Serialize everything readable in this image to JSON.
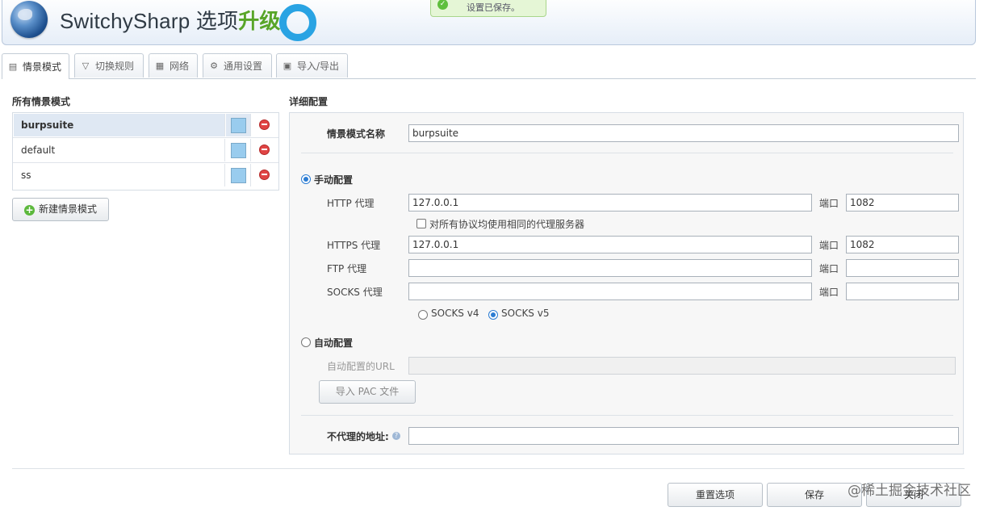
{
  "header": {
    "title": "SwitchySharp 选项",
    "upgrade": "升级"
  },
  "toast": {
    "message": "设置已保存。"
  },
  "tabs": [
    {
      "label": "情景模式",
      "icon": "profile-icon"
    },
    {
      "label": "切换规则",
      "icon": "filter-icon"
    },
    {
      "label": "网络",
      "icon": "network-icon"
    },
    {
      "label": "通用设置",
      "icon": "gear-icon"
    },
    {
      "label": "导入/导出",
      "icon": "save-icon"
    }
  ],
  "left": {
    "title": "所有情景模式",
    "profiles": [
      {
        "name": "burpsuite",
        "color": "#99ccee",
        "selected": true
      },
      {
        "name": "default",
        "color": "#99ccee",
        "selected": false
      },
      {
        "name": "ss",
        "color": "#99ccee",
        "selected": false
      }
    ],
    "new_button": "新建情景模式"
  },
  "detail": {
    "title": "详细配置",
    "profile_name_label": "情景模式名称",
    "profile_name_value": "burpsuite",
    "manual_label": "手动配置",
    "http_label": "HTTP 代理",
    "http_value": "127.0.0.1",
    "port_label": "端口",
    "http_port": "1082",
    "same_proxy_label": "对所有协议均使用相同的代理服务器",
    "https_label": "HTTPS 代理",
    "https_value": "127.0.0.1",
    "https_port": "1082",
    "ftp_label": "FTP 代理",
    "ftp_value": "",
    "ftp_port": "",
    "socks_label": "SOCKS 代理",
    "socks_value": "",
    "socks_port": "",
    "socks_v4": "SOCKS v4",
    "socks_v5": "SOCKS v5",
    "auto_label": "自动配置",
    "auto_url_label": "自动配置的URL",
    "auto_url_value": "",
    "import_pac": "导入 PAC 文件",
    "bypass_label": "不代理的地址:",
    "bypass_value": ""
  },
  "footer": {
    "reset": "重置选项",
    "save": "保存",
    "close": "关闭"
  },
  "watermark": "@稀土掘金技术社区"
}
